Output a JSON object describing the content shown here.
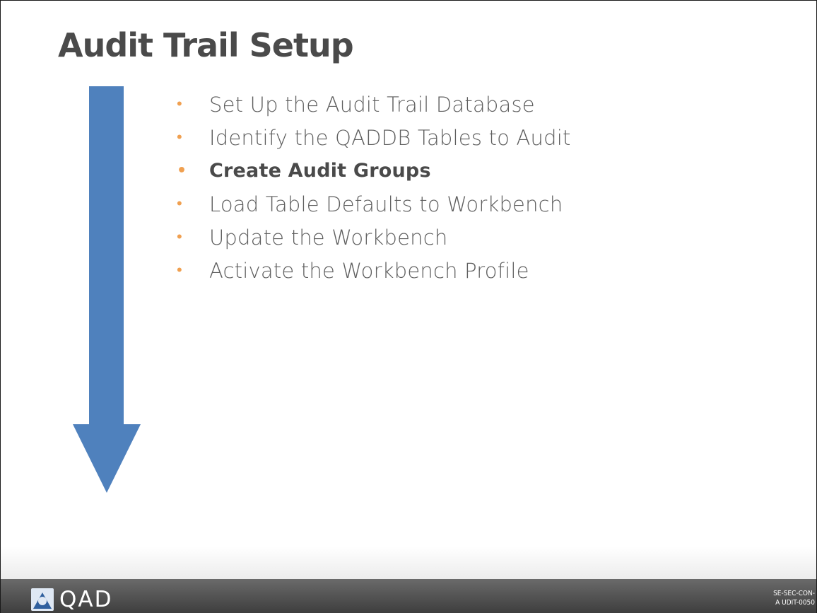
{
  "slide": {
    "title": "Audit Trail Setup",
    "bullets": [
      {
        "text": "Set Up the Audit Trail Database",
        "emphasis": false
      },
      {
        "text": "Identify the QADDB Tables to Audit",
        "emphasis": false
      },
      {
        "text": "Create Audit Groups",
        "emphasis": true
      },
      {
        "text": "Load Table Defaults to Workbench",
        "emphasis": false
      },
      {
        "text": "Update the Workbench",
        "emphasis": false
      },
      {
        "text": "Activate the Workbench Profile",
        "emphasis": false
      }
    ],
    "bullet_symbol": "•"
  },
  "footer": {
    "logo_text": "QAD",
    "logo_icon": "qad-logo-icon",
    "code_line1": "SE-SEC-CON-",
    "code_line2": "A UDIT-0050"
  },
  "decor": {
    "arrow_icon": "down-arrow-icon"
  },
  "colors": {
    "arrow": "#4f81bd",
    "bullet": "#f0a050",
    "title": "#4a4a4a",
    "footer": "#4a4a4a"
  }
}
